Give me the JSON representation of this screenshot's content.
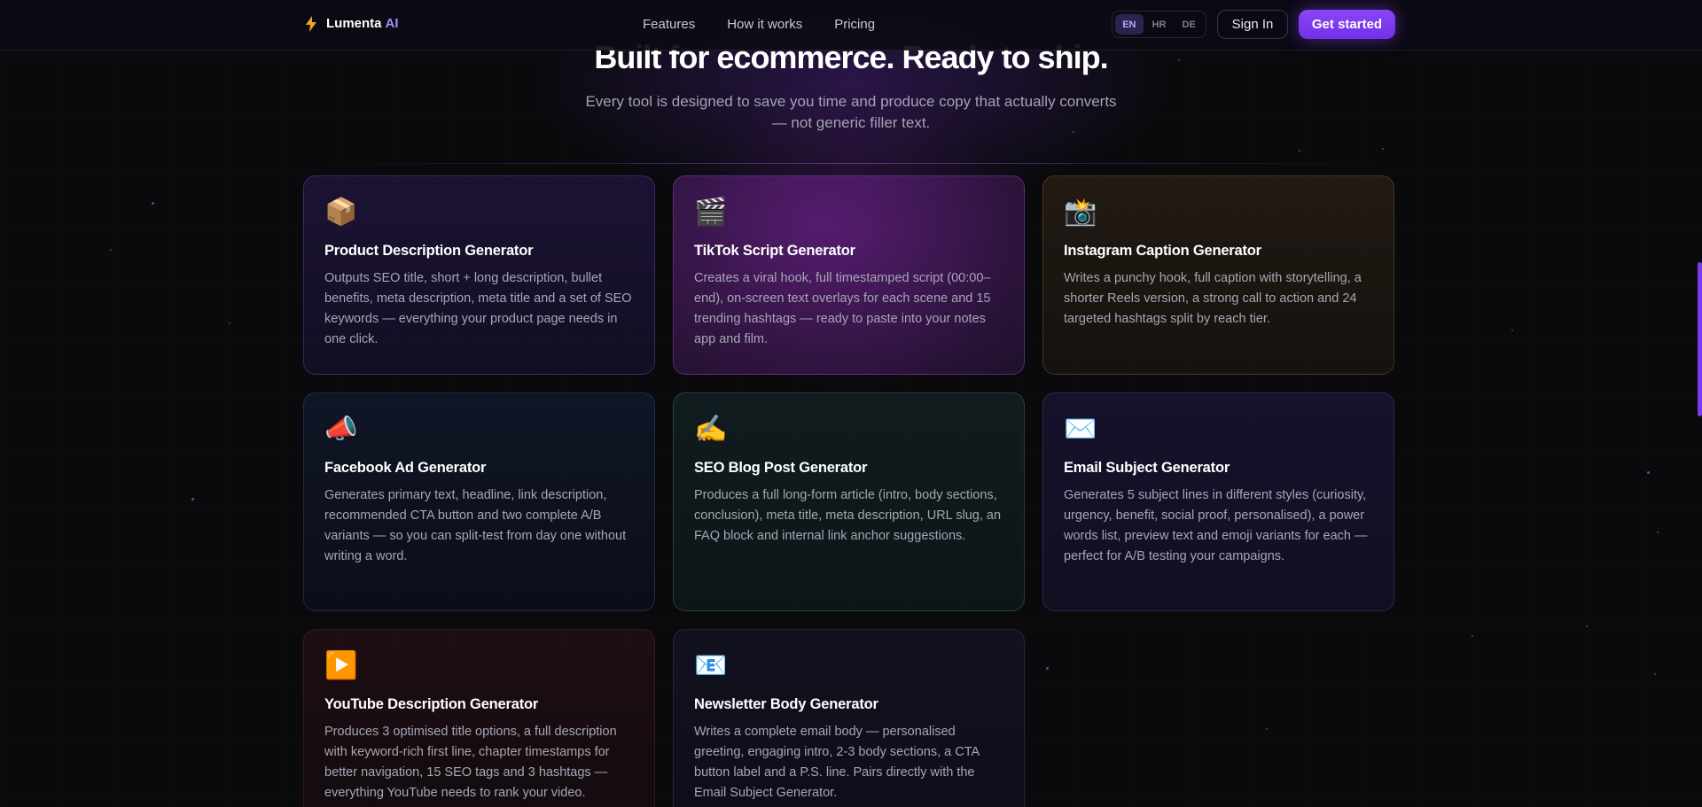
{
  "nav": {
    "brand_name": "Lumenta",
    "brand_ai": "AI",
    "links": [
      "Features",
      "How it works",
      "Pricing"
    ],
    "languages": [
      "EN",
      "HR",
      "DE"
    ],
    "active_language": "EN",
    "sign_in": "Sign In",
    "get_started": "Get started"
  },
  "section": {
    "headline": "Built for ecommerce. Ready to ship.",
    "subline": "Every tool is designed to save you time and produce copy that actually converts — not generic filler text."
  },
  "cards": [
    {
      "icon": "📦",
      "icon_name": "package-icon",
      "title": "Product Description Generator",
      "desc": "Outputs SEO title, short + long description, bullet benefits, meta description, meta title and a set of SEO keywords — everything your product page needs in one click."
    },
    {
      "icon": "🎬",
      "icon_name": "clapperboard-icon",
      "title": "TikTok Script Generator",
      "desc": "Creates a viral hook, full timestamped script (00:00–end), on-screen text overlays for each scene and 15 trending hashtags — ready to paste into your notes app and film."
    },
    {
      "icon": "📸",
      "icon_name": "camera-flash-icon",
      "title": "Instagram Caption Generator",
      "desc": "Writes a punchy hook, full caption with storytelling, a shorter Reels version, a strong call to action and 24 targeted hashtags split by reach tier."
    },
    {
      "icon": "📣",
      "icon_name": "megaphone-icon",
      "title": "Facebook Ad Generator",
      "desc": "Generates primary text, headline, link description, recommended CTA button and two complete A/B variants — so you can split-test from day one without writing a word."
    },
    {
      "icon": "✍️",
      "icon_name": "writing-hand-icon",
      "title": "SEO Blog Post Generator",
      "desc": "Produces a full long-form article (intro, body sections, conclusion), meta title, meta description, URL slug, an FAQ block and internal link anchor suggestions."
    },
    {
      "icon": "✉️",
      "icon_name": "envelope-icon",
      "title": "Email Subject Generator",
      "desc": "Generates 5 subject lines in different styles (curiosity, urgency, benefit, social proof, personalised), a power words list, preview text and emoji variants for each — perfect for A/B testing your campaigns."
    },
    {
      "icon": "▶️",
      "icon_name": "play-button-icon",
      "title": "YouTube Description Generator",
      "desc": "Produces 3 optimised title options, a full description with keyword-rich first line, chapter timestamps for better navigation, 15 SEO tags and 3 hashtags — everything YouTube needs to rank your video."
    },
    {
      "icon": "📧",
      "icon_name": "email-icon",
      "title": "Newsletter Body Generator",
      "desc": "Writes a complete email body — personalised greeting, engaging intro, 2-3 body sections, a CTA button label and a P.S. line. Pairs directly with the Email Subject Generator."
    }
  ],
  "colors": {
    "accent": "#7c3aed",
    "brand_ai": "#a78bfa",
    "background": "#0a0a0d"
  }
}
